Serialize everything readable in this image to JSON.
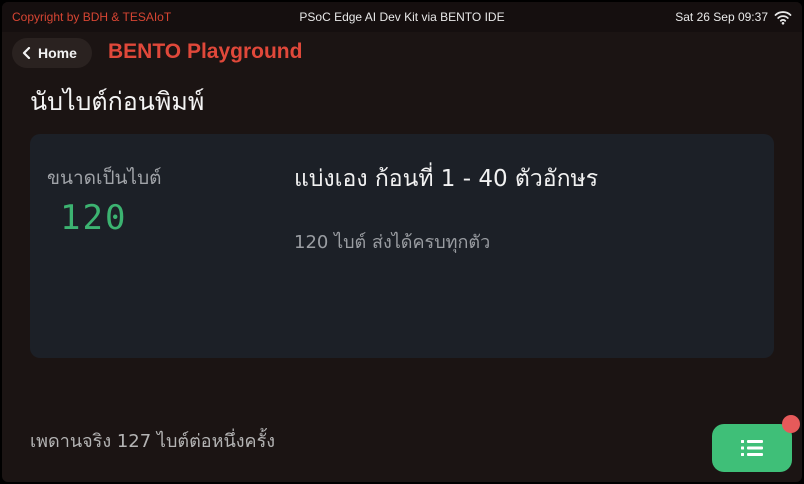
{
  "statusbar": {
    "copyright": "Copyright by BDH & TESAIoT",
    "device_title": "PSoC Edge AI Dev Kit via BENTO IDE",
    "datetime": "Sat 26 Sep 09:37",
    "wifi_icon": "wifi-icon"
  },
  "header": {
    "home_label": "Home",
    "home_icon": "chevron-left-icon",
    "app_title": "BENTO Playground"
  },
  "page": {
    "title": "นับไบต์ก่อนพิมพ์"
  },
  "card": {
    "size_label": "ขนาดเป็นไบต์",
    "size_value": "120",
    "heading": "แบ่งเอง ก้อนที่ 1 - 40 ตัวอักษร",
    "status": "120 ไบต์ ส่งได้ครบทุกตัว"
  },
  "footer": {
    "note": "เพดานจริง 127 ไบต์ต่อหนึ่งครั้ง"
  },
  "fab": {
    "icon": "list-icon"
  },
  "colors": {
    "accent": "#e0483a",
    "value_green": "#3cb371",
    "fab_green": "#3fbf78",
    "badge_red": "#e65a5a"
  }
}
